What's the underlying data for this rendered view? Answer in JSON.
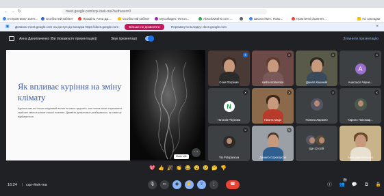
{
  "browser": {
    "url": "meet.google.com/cqx-rkek-ma?authuser=0",
    "bookmarks": [
      {
        "label": "Інтерактивне занят...",
        "color": "#4285f4"
      },
      {
        "label": "Особистий кабінет",
        "color": "#3367d6"
      },
      {
        "label": "Профіль Анна Да...",
        "color": "#ea4335"
      },
      {
        "label": "Особистий кабінет",
        "color": "#fbbc04"
      },
      {
        "label": "MyCollages: Фотоп...",
        "color": "#9c27b0"
      },
      {
        "label": "AbsorbMaths.com ...",
        "color": "#34a853"
      },
      {
        "label": "",
        "color": "#5f6368"
      },
      {
        "label": "Школа №9 г. Ново...",
        "color": "#4285f4"
      },
      {
        "label": "Практичні рішення ...",
        "color": "#ea4335"
      },
      {
        "label": "Усі закладки",
        "color": "#fbbc04"
      }
    ]
  },
  "infobar": {
    "text": "Дозволи meet.google.com на доступ до вкладки https://docs.google.com",
    "allow_button": "Більше не дозволяти",
    "switch_text": "Перемкнути вкладку: docs.google.com"
  },
  "presenter": {
    "name": "Анна Даниільченко (Ви (покажуєте презентацію))",
    "sound_label": "Звук презентації",
    "stop_label": "Зупинити презентацію"
  },
  "slide": {
    "title": "Як впливає куріння на зміну клімату",
    "body": "Куріння має не тільки шкідливий вплив на наше здоров'я, але також може спричинити серйозні зміни в кліматі нашої планети. Давайте детальніше розберемося, як саме це відбувається.",
    "image_label": "Made with"
  },
  "participants": [
    {
      "name": "Соня Погріная",
      "kind": "photo",
      "tone": "#4a3a36"
    },
    {
      "name": "sasha stolarenko",
      "kind": "photo",
      "tone": "#6b4a48"
    },
    {
      "name": "Даниїл Кішинкій",
      "kind": "photo",
      "tone": "#5a5a4a"
    },
    {
      "name": "Анастасія Черне...",
      "kind": "avatar",
      "initial": "A",
      "color": "#9c6fcf"
    },
    {
      "name": "Наталія Рікунова",
      "kind": "avatar",
      "initial": "N",
      "color": "#1e8e3e"
    },
    {
      "name": "Никита Мадо",
      "kind": "photo",
      "tone": "#8a6a4a"
    },
    {
      "name": "Полина Ларкино",
      "kind": "round",
      "tone": "#3c4043"
    },
    {
      "name": "Кирило Пономар...",
      "kind": "round",
      "tone": "#3c4043"
    },
    {
      "name": "Yla Polupanova",
      "kind": "round",
      "tone": "#3c4043"
    },
    {
      "name": "Данило Сорокоусов",
      "kind": "photo",
      "tone": "#9aa0a6"
    },
    {
      "name": "Ще 12 осіб",
      "kind": "round",
      "tone": "#3c4043"
    },
    {
      "name": "Анна Даниільченко",
      "kind": "photo",
      "tone": "#c9b38a"
    }
  ],
  "reactions": [
    "💖",
    "👍",
    "🎉",
    "👏",
    "😂",
    "😮",
    "😢",
    "🤔",
    "👎"
  ],
  "bottom": {
    "time": "16:24",
    "meeting_code": "cqx-rkek-ma",
    "participant_count": "24"
  }
}
